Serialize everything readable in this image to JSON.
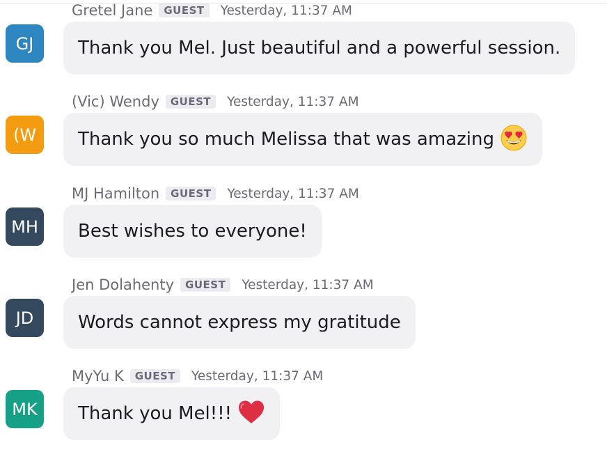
{
  "messages": [
    {
      "name": "Gretel Jane",
      "initials": "GJ",
      "avatar_color": "#2e86c1",
      "badge": "GUEST",
      "time": "Yesterday, 11:37 AM",
      "text": "Thank you Mel. Just beautiful and a powerful session."
    },
    {
      "name": "(Vic) Wendy",
      "initials": "(W",
      "avatar_color": "#f39c12",
      "badge": "GUEST",
      "time": "Yesterday, 11:37 AM",
      "text": "Thank you so much Melissa that was amazing",
      "emoji": "heart-eyes-emoji"
    },
    {
      "name": "MJ Hamilton",
      "initials": "MH",
      "avatar_color": "#34495e",
      "badge": "GUEST",
      "time": "Yesterday, 11:37 AM",
      "text": "Best wishes to everyone!"
    },
    {
      "name": "Jen Dolahenty",
      "initials": "JD",
      "avatar_color": "#34495e",
      "badge": "GUEST",
      "time": "Yesterday, 11:37 AM",
      "text": "Words cannot express my gratitude"
    },
    {
      "name": "MyYu K",
      "initials": "MK",
      "avatar_color": "#16a085",
      "badge": "GUEST",
      "time": "Yesterday, 11:37 AM",
      "text": "Thank you Mel!!!",
      "emoji": "red-heart-emoji"
    }
  ]
}
